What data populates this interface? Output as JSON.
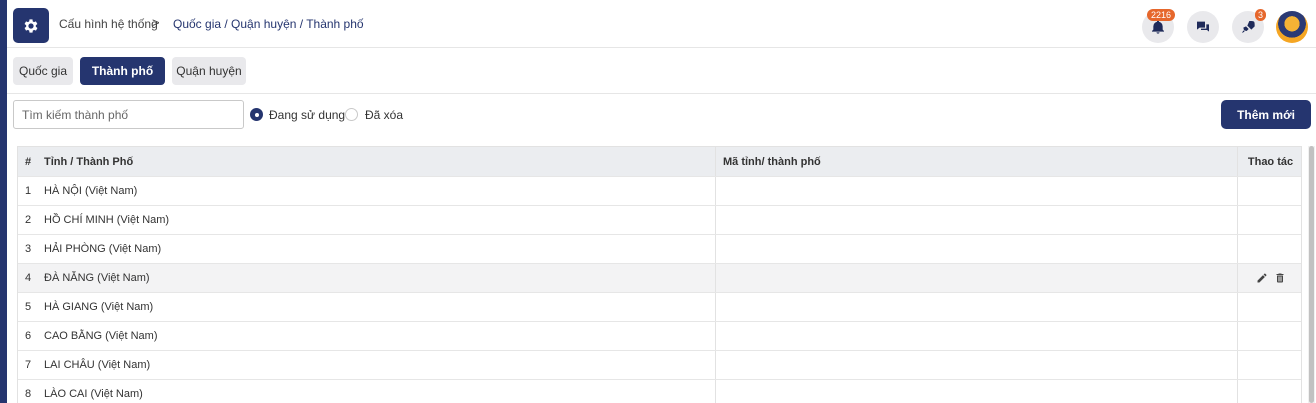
{
  "header": {
    "breadcrumb_root": "Cấu hình hệ thống",
    "breadcrumb_separator": ">",
    "breadcrumb_current": "Quốc gia / Quận huyện / Thành phố",
    "notification_count": "2216",
    "rocket_count": "3",
    "icons": [
      "gear-icon",
      "bell-icon",
      "chat-icon",
      "rocket-icon",
      "avatar"
    ]
  },
  "tabs": [
    {
      "label": "Quốc gia",
      "active": false
    },
    {
      "label": "Thành phố",
      "active": true
    },
    {
      "label": "Quận huyện",
      "active": false
    }
  ],
  "filters": {
    "search_placeholder": "Tìm kiếm thành phố",
    "search_value": "",
    "status_options": [
      {
        "label": "Đang sử dụng",
        "checked": true
      },
      {
        "label": "Đã xóa",
        "checked": false
      }
    ],
    "add_button": "Thêm mới"
  },
  "table": {
    "columns": [
      "#",
      "Tỉnh / Thành Phố",
      "Mã tỉnh/ thành phố",
      "Thao tác"
    ],
    "rows": [
      {
        "index": "1",
        "name": "HÀ NỘI (Việt Nam)",
        "code": ""
      },
      {
        "index": "2",
        "name": "HỒ CHÍ MINH (Việt Nam)",
        "code": ""
      },
      {
        "index": "3",
        "name": "HẢI PHÒNG (Việt Nam)",
        "code": ""
      },
      {
        "index": "4",
        "name": "ĐÀ NẴNG (Việt Nam)",
        "code": "",
        "hovered": true
      },
      {
        "index": "5",
        "name": "HÀ GIANG (Việt Nam)",
        "code": ""
      },
      {
        "index": "6",
        "name": "CAO BẰNG (Việt Nam)",
        "code": ""
      },
      {
        "index": "7",
        "name": "LAI CHÂU (Việt Nam)",
        "code": ""
      },
      {
        "index": "8",
        "name": "LÀO CAI (Việt Nam)",
        "code": ""
      }
    ],
    "row_actions": [
      "edit-icon",
      "delete-icon"
    ]
  },
  "colors": {
    "primary": "#25356f",
    "badge": "#e6672c",
    "tab_inactive": "#e9e9ec",
    "table_header": "#ebedf0"
  }
}
